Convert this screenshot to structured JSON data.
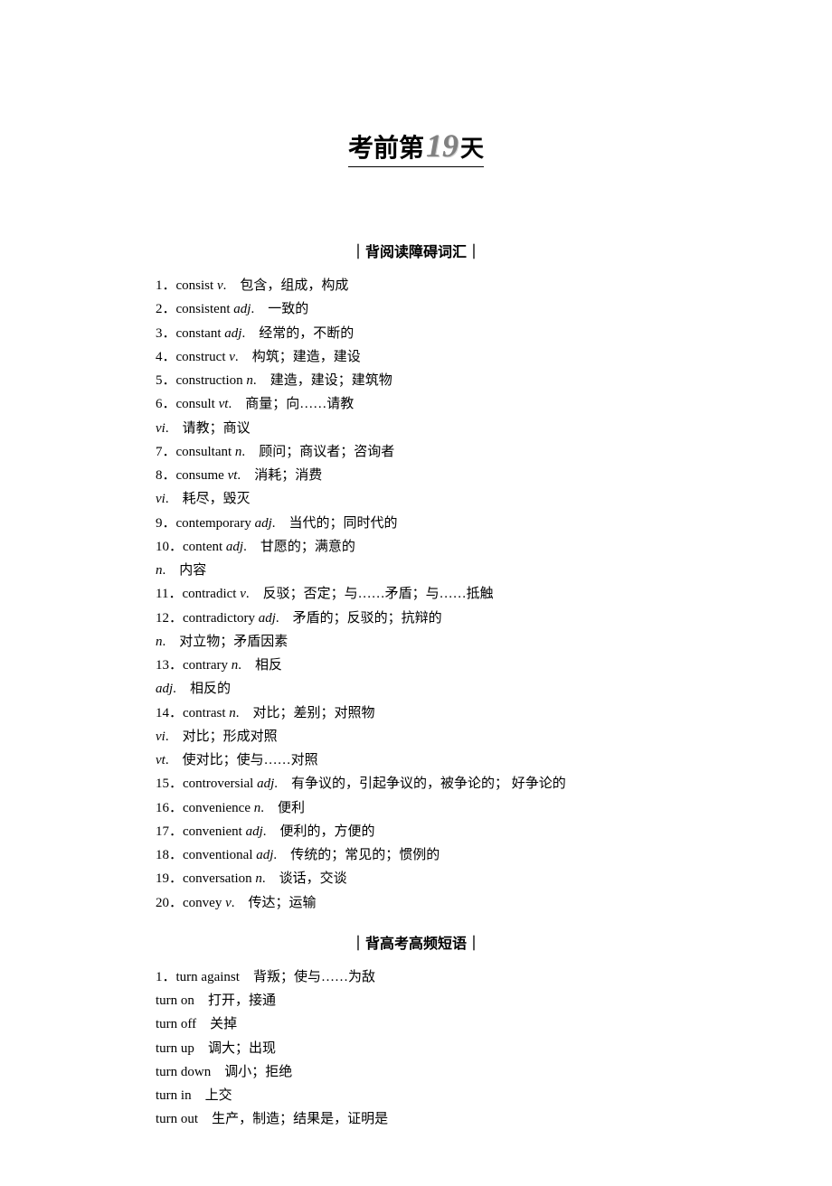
{
  "header": {
    "prefix": "考前第",
    "number": "19",
    "suffix": "天"
  },
  "section1": {
    "title": "｜背阅读障碍词汇｜",
    "entries": [
      {
        "num": "1",
        "word": "consist",
        "pos": "v",
        "def": "包含，组成，构成"
      },
      {
        "num": "2",
        "word": "consistent",
        "pos": "adj",
        "def": "一致的"
      },
      {
        "num": "3",
        "word": "constant",
        "pos": "adj",
        "def": "经常的，不断的"
      },
      {
        "num": "4",
        "word": "construct",
        "pos": "v",
        "def": "构筑；建造，建设"
      },
      {
        "num": "5",
        "word": "construction",
        "pos": "n",
        "def": "建造，建设；建筑物"
      },
      {
        "num": "6",
        "word": "consult",
        "pos": "vt",
        "def": "商量；向……请教"
      },
      {
        "num": "",
        "word": "",
        "pos": "vi",
        "def": "请教；商议"
      },
      {
        "num": "7",
        "word": "consultant",
        "pos": "n",
        "def": "顾问；商议者；咨询者"
      },
      {
        "num": "8",
        "word": "consume",
        "pos": "vt",
        "def": "消耗；消费"
      },
      {
        "num": "",
        "word": "",
        "pos": "vi",
        "def": "耗尽，毁灭"
      },
      {
        "num": "9",
        "word": "contemporary",
        "pos": "adj",
        "def": "当代的；同时代的"
      },
      {
        "num": "10",
        "word": "content",
        "pos": "adj",
        "def": "甘愿的；满意的"
      },
      {
        "num": "",
        "word": "",
        "pos": "n",
        "def": "内容"
      },
      {
        "num": "11",
        "word": "contradict",
        "pos": "v",
        "def": "反驳；否定；与……矛盾；与……抵触"
      },
      {
        "num": "12",
        "word": "contradictory",
        "pos": "adj",
        "def": "矛盾的；反驳的；抗辩的"
      },
      {
        "num": "",
        "word": "",
        "pos": "n",
        "def": "对立物；矛盾因素"
      },
      {
        "num": "13",
        "word": "contrary",
        "pos": "n",
        "def": "相反"
      },
      {
        "num": "",
        "word": "",
        "pos": "adj",
        "def": "相反的"
      },
      {
        "num": "14",
        "word": "contrast",
        "pos": "n",
        "def": "对比；差别；对照物"
      },
      {
        "num": "",
        "word": "",
        "pos": "vi",
        "def": "对比；形成对照"
      },
      {
        "num": "",
        "word": "",
        "pos": "vt",
        "def": "使对比；使与……对照"
      },
      {
        "num": "15",
        "word": "controversial",
        "pos": "adj",
        "def": "有争议的，引起争议的，被争论的；  好争论的"
      },
      {
        "num": "16",
        "word": "convenience",
        "pos": "n",
        "def": "便利"
      },
      {
        "num": "17",
        "word": "convenient",
        "pos": "adj",
        "def": "便利的，方便的"
      },
      {
        "num": "18",
        "word": "conventional",
        "pos": "adj",
        "def": "传统的；常见的；惯例的"
      },
      {
        "num": "19",
        "word": "conversation",
        "pos": "n",
        "def": "谈话，交谈"
      },
      {
        "num": "20",
        "word": "convey",
        "pos": "v",
        "def": "传达；运输"
      }
    ]
  },
  "section2": {
    "title": "｜背高考高频短语｜",
    "entries": [
      {
        "num": "1",
        "word": "turn against",
        "def": "背叛；使与……为敌"
      },
      {
        "num": "",
        "word": "turn on",
        "def": "打开，接通"
      },
      {
        "num": "",
        "word": "turn off",
        "def": "关掉"
      },
      {
        "num": "",
        "word": "turn up",
        "def": "调大；出现"
      },
      {
        "num": "",
        "word": "turn down",
        "def": "调小；拒绝"
      },
      {
        "num": "",
        "word": "turn in",
        "def": "上交"
      },
      {
        "num": "",
        "word": "turn out",
        "def": "生产，制造；结果是，证明是"
      }
    ]
  }
}
